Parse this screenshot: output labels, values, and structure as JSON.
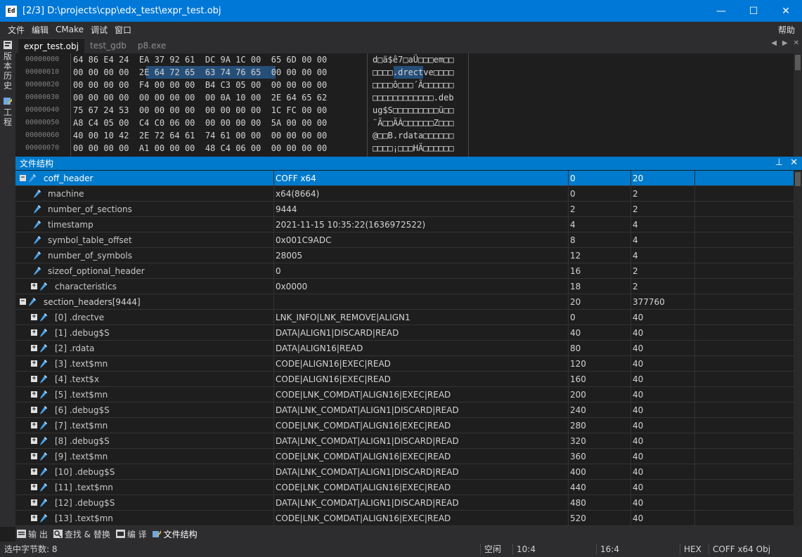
{
  "window": {
    "icon_text": "Ed",
    "title": "[2/3] D:\\projects\\cpp\\edx_test\\expr_test.obj",
    "minimize": "—",
    "maximize": "☐",
    "close": "✕"
  },
  "menu": {
    "items": [
      "文件",
      "编辑",
      "CMake",
      "调试",
      "窗口"
    ],
    "help": "帮助"
  },
  "left_dock": {
    "tabs": [
      "版本历史",
      "工程"
    ]
  },
  "tabs": {
    "items": [
      "expr_test.obj",
      "test_gdb",
      "p8.exe"
    ],
    "active_index": 0
  },
  "hex": {
    "rows": [
      {
        "offset": "00000000",
        "bytes": "64 86 E4 24  EA 37 92 61  DC 9A 1C 00  65 6D 00 00",
        "ascii": "d□ä$ê7□aÜ□□□em□□"
      },
      {
        "offset": "00000010",
        "bytes": "00 00 00 00  2E 64 72 65  63 74 76 65  00 00 00 00",
        "ascii": "□□□□.drectve□□□□"
      },
      {
        "offset": "00000020",
        "bytes": "00 00 00 00  F4 00 00 00  B4 C3 05 00  00 00 00 00",
        "ascii": "□□□□ô□□□´Ã□□□□□□"
      },
      {
        "offset": "00000030",
        "bytes": "00 00 00 00  00 00 00 00  00 0A 10 00  2E 64 65 62",
        "ascii": "□□□□□□□□□□□□.deb"
      },
      {
        "offset": "00000040",
        "bytes": "75 67 24 53  00 00 00 00  00 00 00 00  1C FC 00 00",
        "ascii": "ug$S□□□□□□□□□ü□□"
      },
      {
        "offset": "00000050",
        "bytes": "A8 C4 05 00  C4 C0 06 00  00 00 00 00  5A 00 00 00",
        "ascii": "¨Ä□□ÄÀ□□□□□□Z□□□"
      },
      {
        "offset": "00000060",
        "bytes": "40 00 10 42  2E 72 64 61  74 61 00 00  00 00 00 00",
        "ascii": "@□□B.rdata□□□□□□"
      },
      {
        "offset": "00000070",
        "bytes": "00 00 00 00  A1 00 00 00  48 C4 06 00  00 00 00 00",
        "ascii": "□□□□¡□□□HÄ□□□□□□"
      }
    ]
  },
  "structure": {
    "title": "文件结构",
    "pin": "⊥",
    "close": "✕",
    "rows": [
      {
        "name": "coff_header",
        "value": "COFF x64",
        "offset": "0",
        "size": "20",
        "level": 0,
        "expander": "−",
        "selected": true
      },
      {
        "name": "machine",
        "value": "x64(8664)",
        "offset": "0",
        "size": "2",
        "level": 1,
        "expander": ""
      },
      {
        "name": "number_of_sections",
        "value": "9444",
        "offset": "2",
        "size": "2",
        "level": 1,
        "expander": ""
      },
      {
        "name": "timestamp",
        "value": "2021-11-15 10:35:22(1636972522)",
        "offset": "4",
        "size": "4",
        "level": 1,
        "expander": ""
      },
      {
        "name": "symbol_table_offset",
        "value": "0x001C9ADC",
        "offset": "8",
        "size": "4",
        "level": 1,
        "expander": ""
      },
      {
        "name": "number_of_symbols",
        "value": "28005",
        "offset": "12",
        "size": "4",
        "level": 1,
        "expander": ""
      },
      {
        "name": "sizeof_optional_header",
        "value": "0",
        "offset": "16",
        "size": "2",
        "level": 1,
        "expander": ""
      },
      {
        "name": "characteristics",
        "value": "0x0000",
        "offset": "18",
        "size": "2",
        "level": 1,
        "expander": "+"
      },
      {
        "name": "section_headers[9444]",
        "value": "",
        "offset": "20",
        "size": "377760",
        "level": 0,
        "expander": "−"
      },
      {
        "name": "[0] .drectve",
        "value": "LNK_INFO|LNK_REMOVE|ALIGN1",
        "offset": "0",
        "size": "40",
        "level": 1,
        "expander": "+"
      },
      {
        "name": "[1] .debug$S",
        "value": "DATA|ALIGN1|DISCARD|READ",
        "offset": "40",
        "size": "40",
        "level": 1,
        "expander": "+"
      },
      {
        "name": "[2] .rdata",
        "value": "DATA|ALIGN16|READ",
        "offset": "80",
        "size": "40",
        "level": 1,
        "expander": "+"
      },
      {
        "name": "[3] .text$mn",
        "value": "CODE|ALIGN16|EXEC|READ",
        "offset": "120",
        "size": "40",
        "level": 1,
        "expander": "+"
      },
      {
        "name": "[4] .text$x",
        "value": "CODE|ALIGN16|EXEC|READ",
        "offset": "160",
        "size": "40",
        "level": 1,
        "expander": "+"
      },
      {
        "name": "[5] .text$mn",
        "value": "CODE|LNK_COMDAT|ALIGN16|EXEC|READ",
        "offset": "200",
        "size": "40",
        "level": 1,
        "expander": "+"
      },
      {
        "name": "[6] .debug$S",
        "value": "DATA|LNK_COMDAT|ALIGN1|DISCARD|READ",
        "offset": "240",
        "size": "40",
        "level": 1,
        "expander": "+"
      },
      {
        "name": "[7] .text$mn",
        "value": "CODE|LNK_COMDAT|ALIGN16|EXEC|READ",
        "offset": "280",
        "size": "40",
        "level": 1,
        "expander": "+"
      },
      {
        "name": "[8] .debug$S",
        "value": "DATA|LNK_COMDAT|ALIGN1|DISCARD|READ",
        "offset": "320",
        "size": "40",
        "level": 1,
        "expander": "+"
      },
      {
        "name": "[9] .text$mn",
        "value": "CODE|LNK_COMDAT|ALIGN16|EXEC|READ",
        "offset": "360",
        "size": "40",
        "level": 1,
        "expander": "+"
      },
      {
        "name": "[10] .debug$S",
        "value": "DATA|LNK_COMDAT|ALIGN1|DISCARD|READ",
        "offset": "400",
        "size": "40",
        "level": 1,
        "expander": "+"
      },
      {
        "name": "[11] .text$mn",
        "value": "CODE|LNK_COMDAT|ALIGN16|EXEC|READ",
        "offset": "440",
        "size": "40",
        "level": 1,
        "expander": "+"
      },
      {
        "name": "[12] .debug$S",
        "value": "DATA|LNK_COMDAT|ALIGN1|DISCARD|READ",
        "offset": "480",
        "size": "40",
        "level": 1,
        "expander": "+"
      },
      {
        "name": "[13] .text$mn",
        "value": "CODE|LNK_COMDAT|ALIGN16|EXEC|READ",
        "offset": "520",
        "size": "40",
        "level": 1,
        "expander": "+"
      }
    ]
  },
  "bottom_tabs": [
    {
      "label": "输 出",
      "icon": "output-icon"
    },
    {
      "label": "查找 & 替换",
      "icon": "search-replace-icon"
    },
    {
      "label": "编 译",
      "icon": "build-icon"
    },
    {
      "label": "文件结构",
      "icon": "file-structure-icon",
      "active": true
    }
  ],
  "status": {
    "selected_bytes": "选中字节数: 8",
    "state": "空闲",
    "pos1": "10:4",
    "pos2": "16:4",
    "mode": "HEX",
    "format": "COFF x64 Obj"
  },
  "colors": {
    "accent": "#007acc",
    "titlebar": "#0078d7",
    "background": "#1e1e1e",
    "selection": "#264f78"
  }
}
